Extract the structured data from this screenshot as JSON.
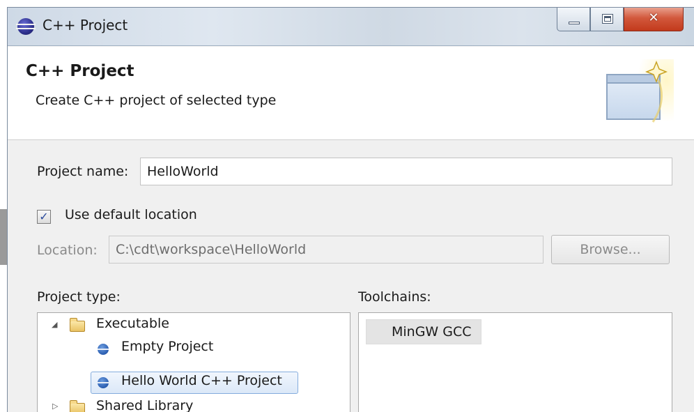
{
  "window": {
    "title": "C++ Project",
    "controls": {
      "minimize_glyph": "",
      "maximize_glyph": "",
      "close_glyph": "✕"
    }
  },
  "banner": {
    "title": "C++ Project",
    "subtitle": "Create C++ project of selected type"
  },
  "form": {
    "project_name_label": "Project name:",
    "project_name_value": "HelloWorld",
    "use_default_location_label": "Use default location",
    "use_default_location_checked": true,
    "checkbox_mark": "✓",
    "location_label": "Location:",
    "location_value": "C:\\cdt\\workspace\\HelloWorld",
    "browse_label": "Browse..."
  },
  "project_type": {
    "label": "Project type:",
    "tree": [
      {
        "label": "Executable",
        "type": "folder",
        "expanded": true,
        "expander": "◢"
      },
      {
        "label": "Empty Project",
        "type": "item"
      },
      {
        "label": "Hello World C++ Project",
        "type": "item",
        "selected": true
      },
      {
        "label": "Shared Library",
        "type": "folder",
        "expanded": false,
        "expander": "▷"
      }
    ]
  },
  "toolchains": {
    "label": "Toolchains:",
    "items": [
      {
        "label": "MinGW GCC"
      }
    ]
  },
  "colors": {
    "selection_border": "#84acdd",
    "close_button": "#c23a1c",
    "titlebar": "#dfe7f0"
  }
}
